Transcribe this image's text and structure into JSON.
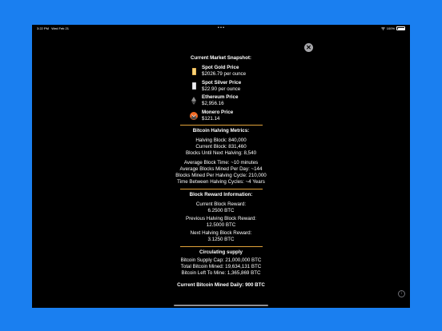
{
  "status": {
    "time": "3:22 PM",
    "date": "Wed Feb 21",
    "dots": "• • •",
    "battery_percent": "100%",
    "battery_level": 1.0
  },
  "snapshot": {
    "title": "Current Market Snapshot:",
    "items": [
      {
        "name": "Spot Gold Price",
        "value": "$2026.79 per ounce",
        "icon": "gold-bar-icon",
        "color": "#e8b04a"
      },
      {
        "name": "Spot Silver Price",
        "value": "$22.90 per ounce",
        "icon": "silver-bar-icon",
        "color": "#c9c9cc"
      },
      {
        "name": "Ethereum Price",
        "value": "$2,956.16",
        "icon": "ethereum-icon",
        "color": "#8c8c8c"
      },
      {
        "name": "Monero Price",
        "value": "$121.14",
        "icon": "monero-icon",
        "color": "#f26822"
      }
    ]
  },
  "halving": {
    "title": "Bitcoin Halving Metrics:",
    "halving_block": "Halving Block: 840,000",
    "current_block": "Current Block: 831,460",
    "blocks_until": "Blocks Until Next Halving: 8,540",
    "avg_block_time": "Average Block Time: ~10 minutes",
    "avg_blocks_day": "Average Blocks Mined Per Day: ~144",
    "blocks_per_cycle": "Blocks Mined Per Halving Cycle: 210,000",
    "time_between": "Time Between Halving Cycles: ~4 Years"
  },
  "reward": {
    "title": "Block Reward Information:",
    "current_label": "Current Block Reward:",
    "current_value": "6.2500 BTC",
    "previous_label": "Previous Halving Block Reward:",
    "previous_value": "12.5000 BTC",
    "next_label": "Next Halving Block Reward:",
    "next_value": "3.1250 BTC"
  },
  "supply": {
    "title": "Circulating supply",
    "cap": "Bitcoin Supply Cap: 21,000,000 BTC",
    "total_mined": "Total Bitcoin Mined: 19,634,131 BTC",
    "left_to_mine": "Bitcoin Left To Mine: 1,365,869 BTC"
  },
  "daily": "Current Bitcoin Mined Daily: 900 BTC",
  "colors": {
    "background": "#1a7ff0",
    "screen": "#000000",
    "divider": "#e1a23a",
    "text": "#ffffff"
  },
  "icons": {
    "close": "close-icon",
    "info": "info-icon"
  }
}
